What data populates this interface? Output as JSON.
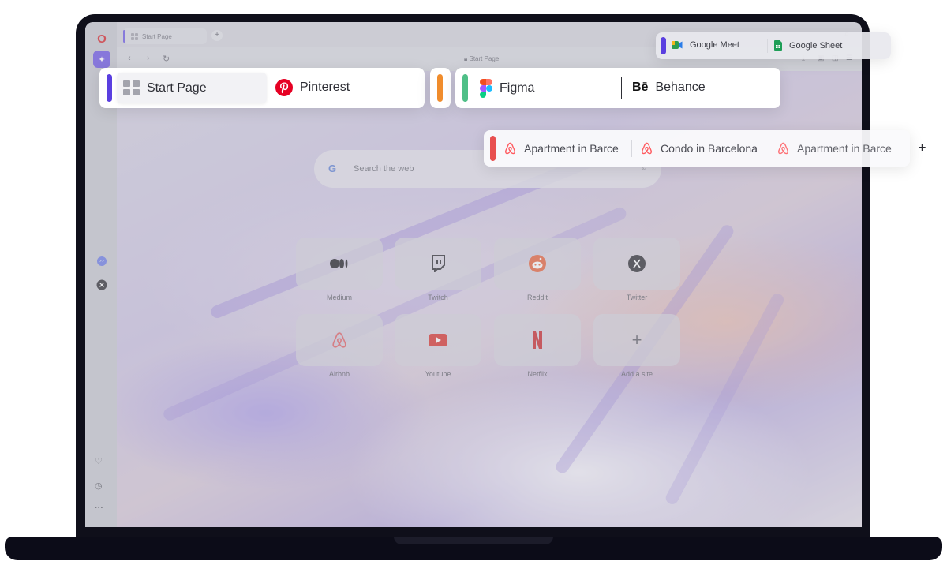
{
  "colors": {
    "workspace_purple": "#5a3fe0",
    "workspace_orange": "#f08c2c",
    "workspace_green": "#4fbf87",
    "workspace_red": "#e84f4f",
    "opera_red": "#d91f26",
    "airbnb": "#ff5a5f",
    "pinterest": "#e60023"
  },
  "browser": {
    "tab": {
      "label": "Start Page"
    },
    "address": {
      "url": "Start Page"
    },
    "search": {
      "placeholder": "Search the web",
      "icon": "google-icon"
    },
    "speed_dials": [
      {
        "label": "Medium",
        "icon": "medium-icon"
      },
      {
        "label": "Twitch",
        "icon": "twitch-icon"
      },
      {
        "label": "Reddit",
        "icon": "reddit-icon"
      },
      {
        "label": "Twitter",
        "icon": "x-icon"
      },
      {
        "label": "Airbnb",
        "icon": "airbnb-icon"
      },
      {
        "label": "Youtube",
        "icon": "youtube-icon"
      },
      {
        "label": "Netflix",
        "icon": "netflix-icon"
      },
      {
        "label": "Add a site",
        "icon": "plus-icon"
      }
    ]
  },
  "floating_tabs": {
    "top_right": [
      {
        "label": "Google Meet",
        "icon": "google-meet-icon"
      },
      {
        "label": "Google Sheet",
        "icon": "google-sheets-icon"
      }
    ],
    "main_left": [
      {
        "label": "Start Page",
        "icon": "grid-icon"
      },
      {
        "label": "Pinterest",
        "icon": "pinterest-icon"
      }
    ],
    "main_right": [
      {
        "label": "Figma",
        "icon": "figma-icon"
      },
      {
        "label": "Behance",
        "icon": "behance-icon",
        "logo_text": "Bē"
      }
    ],
    "airbnb_group": [
      {
        "label": "Apartment in Barce",
        "icon": "airbnb-icon"
      },
      {
        "label": "Condo in Barcelona",
        "icon": "airbnb-icon"
      },
      {
        "label": "Apartment in Barce",
        "icon": "airbnb-icon"
      }
    ],
    "new_tab": "+"
  }
}
